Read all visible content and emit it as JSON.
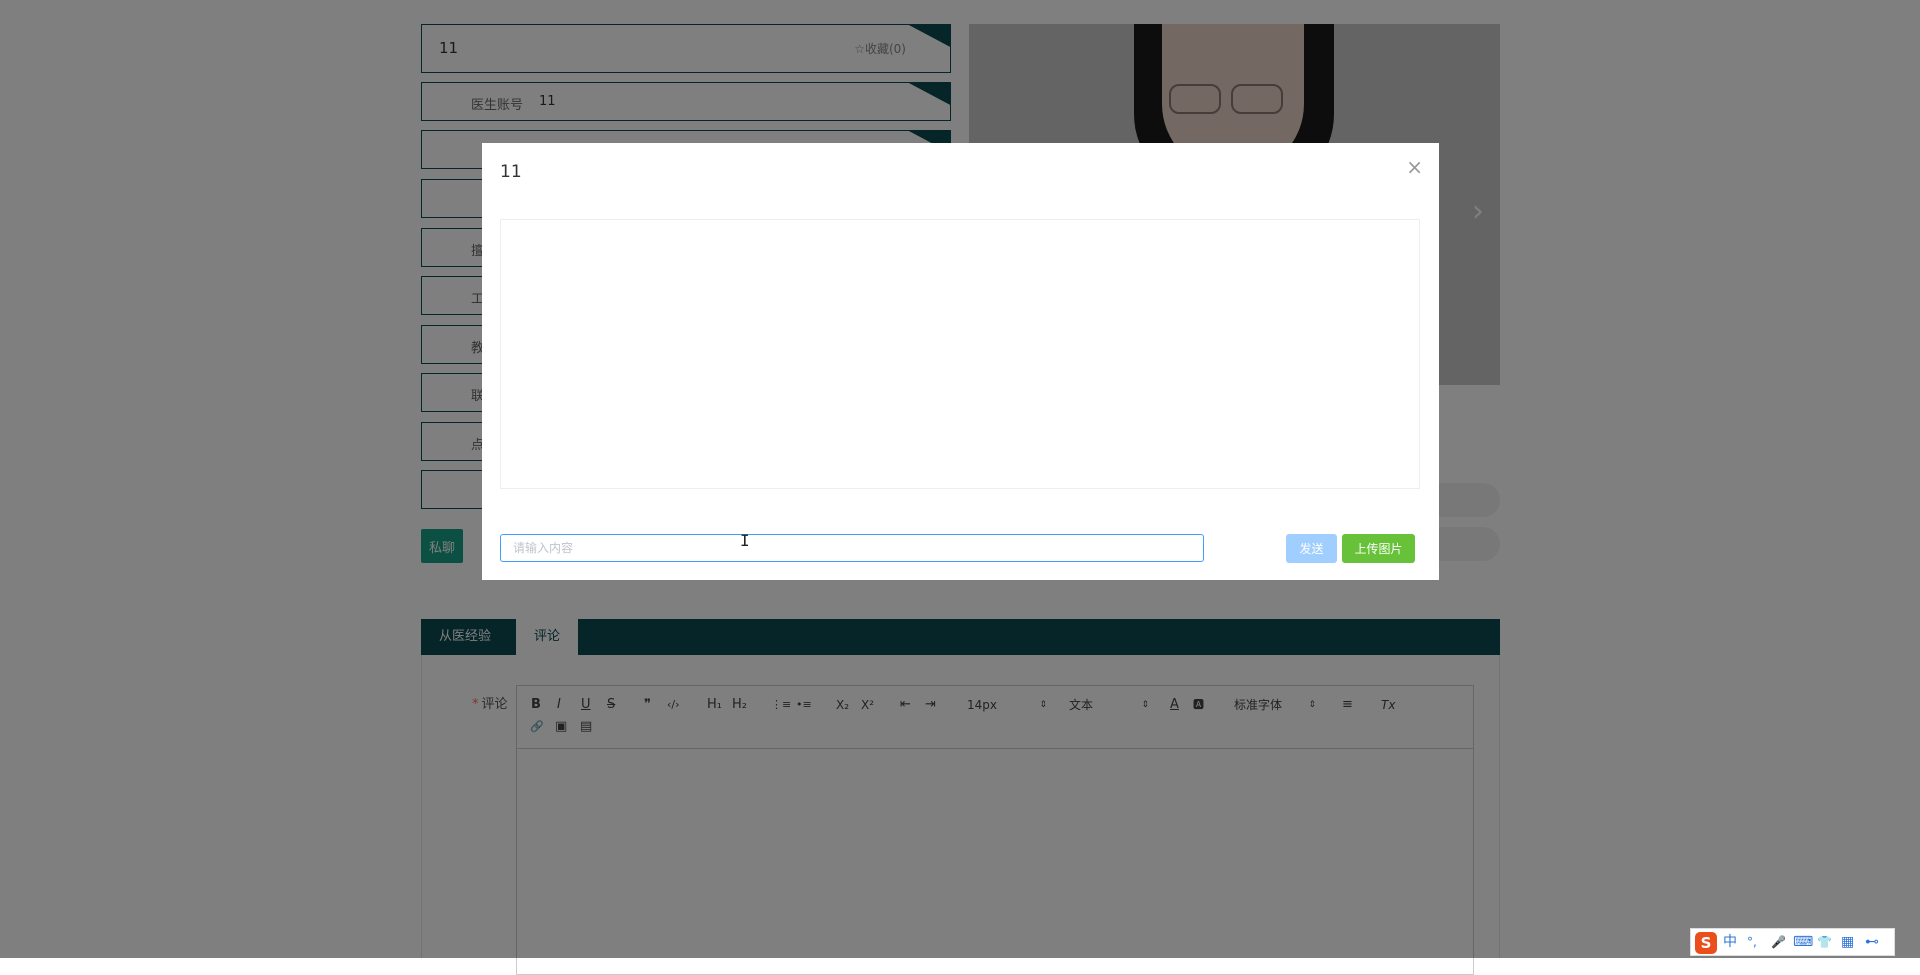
{
  "doctor": {
    "title": "11",
    "favorite_label": "☆收藏(0)",
    "account_label": "医生账号",
    "account_value": "11",
    "rows": [
      "",
      "",
      "擅",
      "工",
      "教",
      "联",
      "点",
      ""
    ]
  },
  "chat_button_label": "私聊",
  "tabs": [
    {
      "label": "从医经验",
      "active": false
    },
    {
      "label": "评论",
      "active": true
    }
  ],
  "comment": {
    "required_mark": "*",
    "label": "评论"
  },
  "editor_toolbar": {
    "buttons": [
      {
        "name": "bold",
        "glyph": "B"
      },
      {
        "name": "italic",
        "glyph": "I"
      },
      {
        "name": "underline",
        "glyph": "U"
      },
      {
        "name": "strike",
        "glyph": "S"
      },
      {
        "name": "blockquote",
        "glyph": "❞"
      },
      {
        "name": "code-block",
        "glyph": "‹/›"
      },
      {
        "name": "header-1",
        "glyph": "H₁"
      },
      {
        "name": "header-2",
        "glyph": "H₂"
      },
      {
        "name": "ordered-list",
        "glyph": "⋮≡"
      },
      {
        "name": "bullet-list",
        "glyph": "•≡"
      },
      {
        "name": "subscript",
        "glyph": "X₂"
      },
      {
        "name": "superscript",
        "glyph": "X²"
      },
      {
        "name": "outdent",
        "glyph": "⇤"
      },
      {
        "name": "indent",
        "glyph": "⇥"
      },
      {
        "name": "font-color",
        "glyph": "A"
      },
      {
        "name": "background-color",
        "glyph": "🅰"
      },
      {
        "name": "align",
        "glyph": "≡"
      },
      {
        "name": "clean",
        "glyph": "Tx"
      },
      {
        "name": "link",
        "glyph": "🔗"
      },
      {
        "name": "image",
        "glyph": "▣"
      },
      {
        "name": "video",
        "glyph": "▤"
      }
    ],
    "size_select": "14px",
    "header_select": "文本",
    "font_select": "标准字体"
  },
  "modal": {
    "title": "11",
    "close_glyph": "×",
    "input_placeholder": "请输入内容",
    "send_label": "发送",
    "upload_label": "上传图片"
  },
  "ime": {
    "logo": "S",
    "mode": "中",
    "punct": "°,",
    "mic": "🎤",
    "keyboard": "⌨",
    "skin": "👕",
    "toolbox": "▦",
    "extra": "⊷"
  },
  "colors": {
    "teal": "#0b4a53",
    "chat_green": "#16a085",
    "send_blue": "#a0cfff",
    "upload_green": "#67c23a"
  }
}
